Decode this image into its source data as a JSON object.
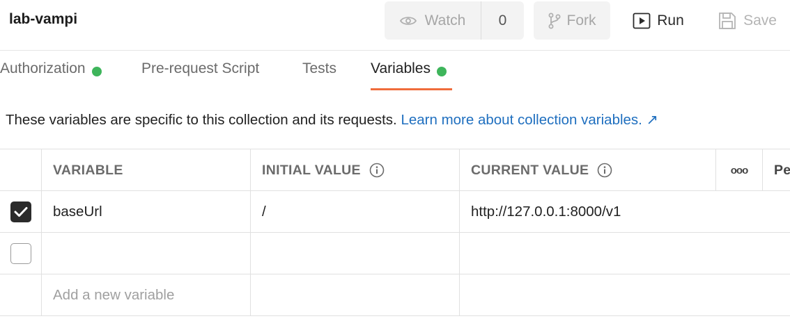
{
  "header": {
    "title": "lab-vampi",
    "watch_label": "Watch",
    "watch_count": "0",
    "fork_label": "Fork",
    "run_label": "Run",
    "save_label": "Save"
  },
  "tabs": [
    {
      "label": "Authorization",
      "dot": true
    },
    {
      "label": "Pre-request Script",
      "dot": false
    },
    {
      "label": "Tests",
      "dot": false
    },
    {
      "label": "Variables",
      "dot": true,
      "active": true
    }
  ],
  "info": {
    "text": "These variables are specific to this collection and its requests.",
    "link": "Learn more about collection variables. ↗"
  },
  "table": {
    "headers": [
      "VARIABLE",
      "INITIAL VALUE",
      "CURRENT VALUE",
      "Pe"
    ],
    "more_label": "ooo",
    "rows": [
      {
        "checked": true,
        "variable": "baseUrl",
        "initial": "/",
        "current": "http://127.0.0.1:8000/v1"
      },
      {
        "checked": false,
        "variable": "",
        "initial": "",
        "current": ""
      }
    ],
    "add_placeholder": "Add a new variable"
  },
  "colors": {
    "accent": "#ef6c3b",
    "dot": "#3eb55b",
    "link": "#1f6fbf"
  }
}
